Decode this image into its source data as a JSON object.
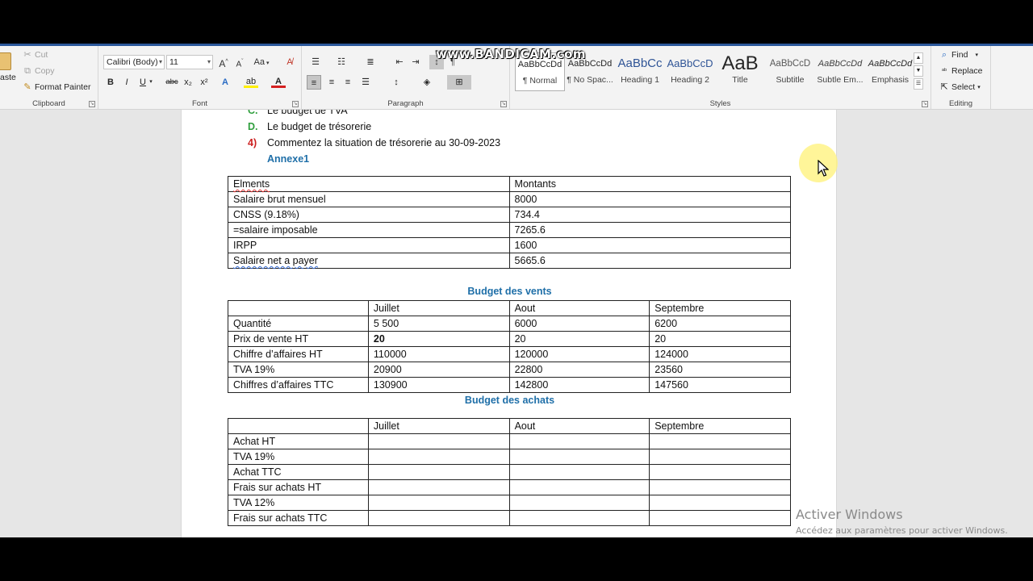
{
  "watermark": "www.BANDICAM.com",
  "ribbon": {
    "clipboard": {
      "paste": "aste",
      "cut": "Cut",
      "copy": "Copy",
      "format_painter": "Format Painter",
      "label": "Clipboard"
    },
    "font": {
      "font_name": "Calibri (Body)",
      "font_size": "11",
      "bold": "B",
      "italic": "I",
      "underline": "U",
      "strike": "abc",
      "subscript": "x₂",
      "superscript": "x²",
      "grow": "A",
      "shrink": "A",
      "case": "Aa",
      "label": "Font"
    },
    "paragraph": {
      "label": "Paragraph"
    },
    "styles": {
      "label": "Styles",
      "items": [
        {
          "preview": "AaBbCcDd",
          "name": "¶ Normal"
        },
        {
          "preview": "AaBbCcDd",
          "name": "¶ No Spac..."
        },
        {
          "preview": "AaBbCc",
          "name": "Heading 1"
        },
        {
          "preview": "AaBbCcD",
          "name": "Heading 2"
        },
        {
          "preview": "AaB",
          "name": "Title"
        },
        {
          "preview": "AaBbCcD",
          "name": "Subtitle"
        },
        {
          "preview": "AaBbCcDd",
          "name": "Subtle Em..."
        },
        {
          "preview": "AaBbCcDd",
          "name": "Emphasis"
        }
      ]
    },
    "editing": {
      "find": "Find",
      "replace": "Replace",
      "select": "Select",
      "label": "Editing"
    }
  },
  "document": {
    "lines": [
      {
        "num": "C.",
        "text": "Le budget de TVA"
      },
      {
        "num": "D.",
        "text": "Le budget de trésorerie"
      },
      {
        "num": "4)",
        "text": "Commentez la situation de trésorerie au 30-09-2023"
      }
    ],
    "annexe": "Annexe1",
    "salary_table": {
      "headers": [
        "Elments",
        "Montants"
      ],
      "rows": [
        [
          "Salaire brut mensuel",
          "8000"
        ],
        [
          "CNSS (9.18%)",
          "734.4"
        ],
        [
          "=salaire imposable",
          "7265.6"
        ],
        [
          "IRPP",
          "1600"
        ],
        [
          "Salaire net a payer",
          "5665.6"
        ]
      ]
    },
    "sales_title": "Budget des vents",
    "sales_table": {
      "headers": [
        "",
        "Juillet",
        "Aout",
        "Septembre"
      ],
      "rows": [
        [
          "Quantité",
          "5 500",
          "6000",
          "6200"
        ],
        [
          "Prix de vente HT",
          "20",
          "20",
          "20"
        ],
        [
          "Chiffre d’affaires HT",
          "110000",
          "120000",
          "124000"
        ],
        [
          "TVA 19%",
          "20900",
          "22800",
          "23560"
        ],
        [
          "Chiffres d’affaires TTC",
          "130900",
          "142800",
          "147560"
        ]
      ]
    },
    "purchases_title": "Budget des achats",
    "purchases_table": {
      "headers": [
        "",
        "Juillet",
        "Aout",
        "Septembre"
      ],
      "rows": [
        [
          "Achat HT",
          "",
          "",
          ""
        ],
        [
          "TVA 19%",
          "",
          "",
          ""
        ],
        [
          "Achat TTC",
          "",
          "",
          ""
        ],
        [
          "Frais sur achats HT",
          "",
          "",
          ""
        ],
        [
          "TVA 12%",
          "",
          "",
          ""
        ],
        [
          "Frais sur achats TTC",
          "",
          "",
          ""
        ]
      ]
    }
  },
  "activation": {
    "title": "Activer Windows",
    "subtitle": "Accédez aux paramètres pour activer Windows."
  },
  "colors": {
    "accent": "#2b579a",
    "heading": "#1f6fa8",
    "list_green": "#2e9e3c",
    "list_red": "#cc1f1f"
  }
}
